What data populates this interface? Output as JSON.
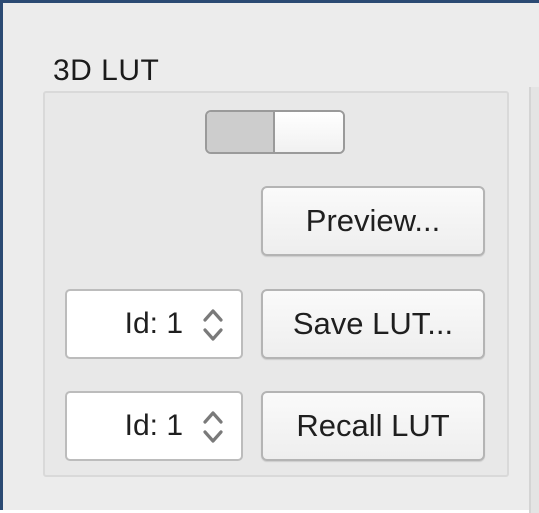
{
  "panel": {
    "title": "3D LUT"
  },
  "toggle": {
    "state": "off"
  },
  "buttons": {
    "preview": "Preview...",
    "save_lut": "Save LUT...",
    "recall_lut": "Recall LUT"
  },
  "save_id": {
    "value": "Id: 1"
  },
  "recall_id": {
    "value": "Id: 1"
  },
  "icons": {
    "stepper": "up-down-chevron-icon"
  }
}
